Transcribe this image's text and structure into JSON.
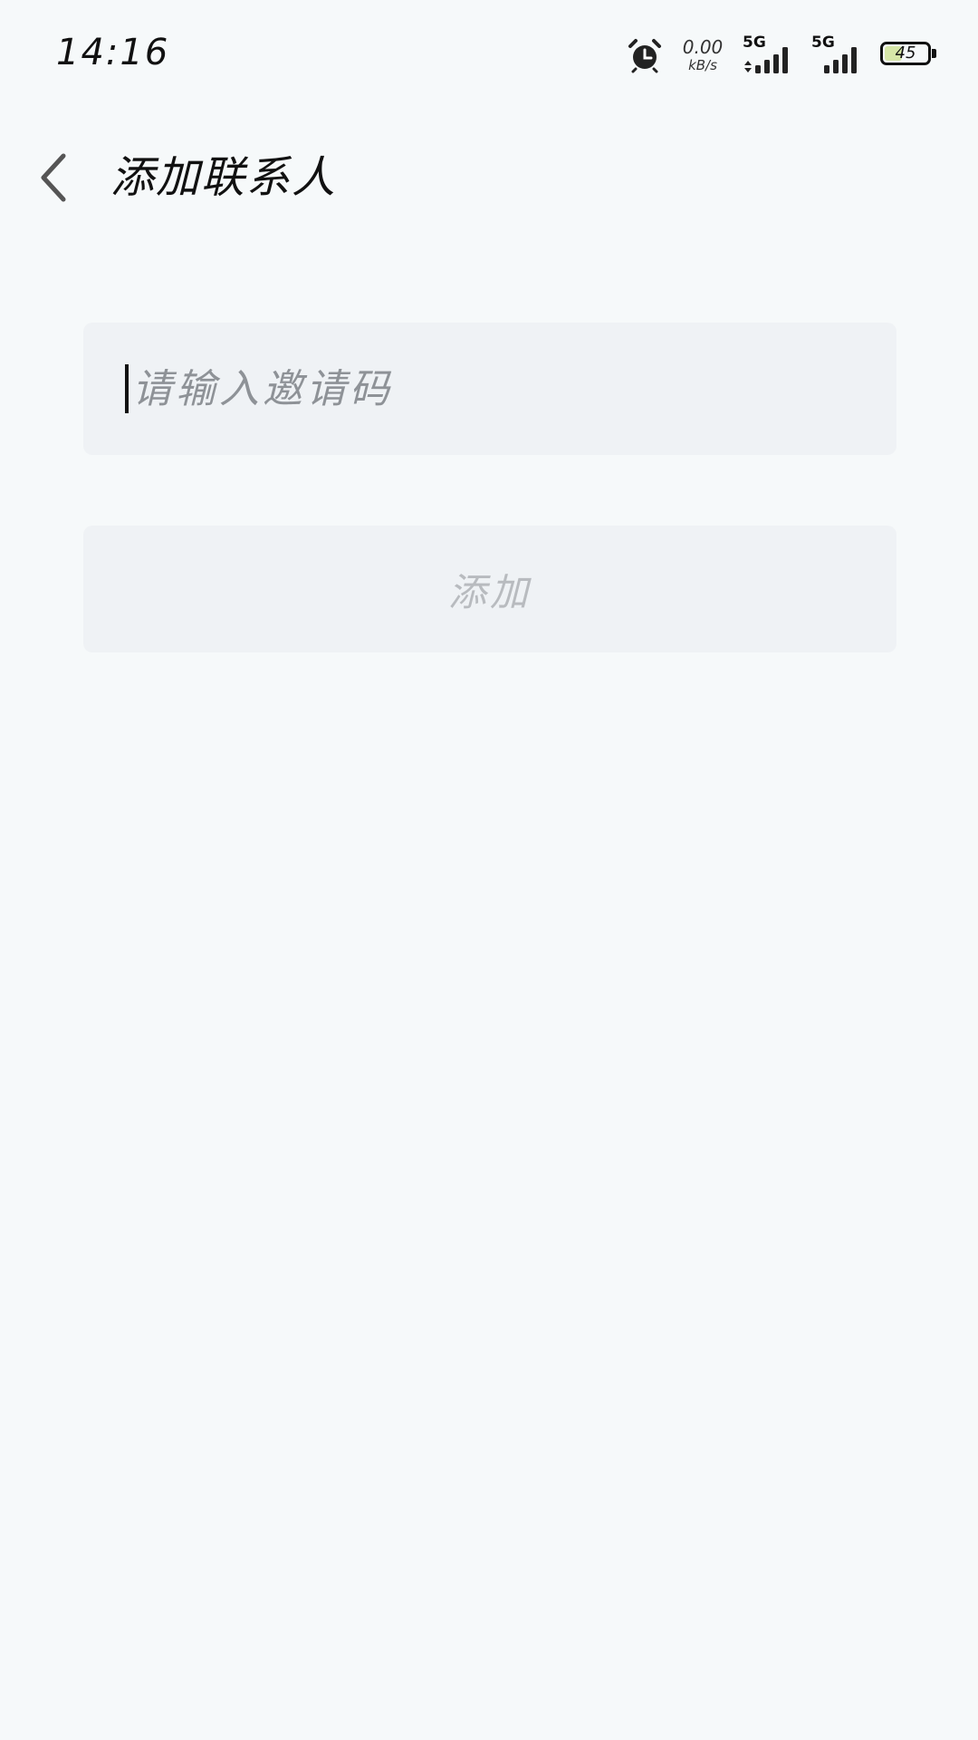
{
  "status_bar": {
    "time": "14:16",
    "net_speed_value": "0.00",
    "net_speed_unit": "kB/s",
    "sim1_label": "5G",
    "sim2_label": "5G",
    "battery_level": "45",
    "icons": [
      "alarm-icon",
      "signal-icon",
      "battery-icon"
    ]
  },
  "header": {
    "title": "添加联系人",
    "back_icon": "chevron-left-icon"
  },
  "form": {
    "invite_code_value": "",
    "invite_code_placeholder": "请输入邀请码",
    "add_button_label": "添加"
  },
  "colors": {
    "background": "#F6F9FA",
    "field_background": "#EFF2F5",
    "placeholder_text": "#8E9297",
    "disabled_button_text": "#B8BBBF",
    "battery_fill": "#D7E7A8"
  }
}
